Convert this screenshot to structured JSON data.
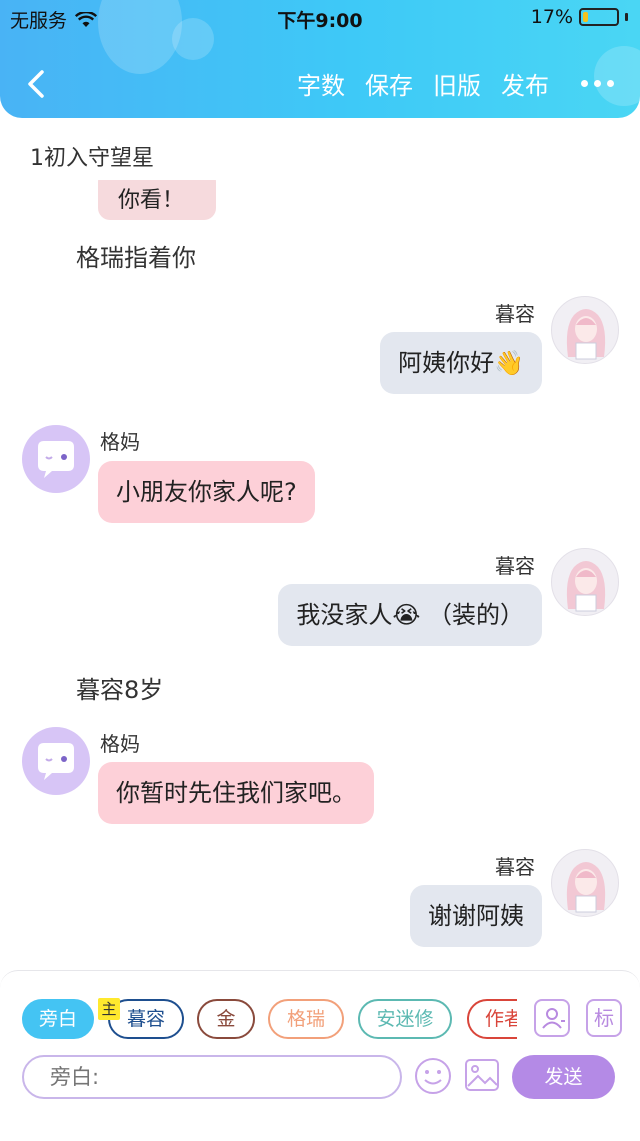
{
  "status_bar": {
    "carrier": "无服务",
    "time": "下午9:00",
    "battery_text": "17%",
    "battery_level": 0.17
  },
  "nav": {
    "actions": [
      "字数",
      "保存",
      "旧版",
      "发布"
    ]
  },
  "chapter_title": "1初入守望星",
  "partial_message": "你看！",
  "messages": [
    {
      "type": "narration",
      "text": "格瑞指着你"
    },
    {
      "type": "right",
      "speaker": "暮容",
      "text": "阿姨你好👋"
    },
    {
      "type": "left",
      "speaker": "格妈",
      "text": "小朋友你家人呢?"
    },
    {
      "type": "right",
      "speaker": "暮容",
      "text": "我没家人😭 （装的）"
    },
    {
      "type": "narration",
      "text": "暮容8岁"
    },
    {
      "type": "left",
      "speaker": "格妈",
      "text": "你暂时先住我们家吧。"
    },
    {
      "type": "right",
      "speaker": "暮容",
      "text": "谢谢阿姨"
    }
  ],
  "toolbar": {
    "main_badge": "主",
    "chips": [
      {
        "label": "旁白",
        "color": "#44c4f3",
        "active": true
      },
      {
        "label": "暮容",
        "color": "#1e4f8f",
        "active": false
      },
      {
        "label": "金",
        "color": "#8a4a3c",
        "active": false
      },
      {
        "label": "格瑞",
        "color": "#f2a07a",
        "active": false
      },
      {
        "label": "安迷修",
        "color": "#5cb9b2",
        "active": false
      },
      {
        "label": "作者",
        "color": "#d9453a",
        "active": false
      }
    ],
    "tag_icon_label": "标",
    "input_placeholder": "旁白:",
    "send_label": "发送"
  },
  "colors": {
    "header_gradient": [
      "#49b3f5",
      "#4ad6f4"
    ],
    "left_bubble": "#fdd0d8",
    "right_bubble": "#e3e7ef",
    "accent_purple": "#b48ae6"
  }
}
